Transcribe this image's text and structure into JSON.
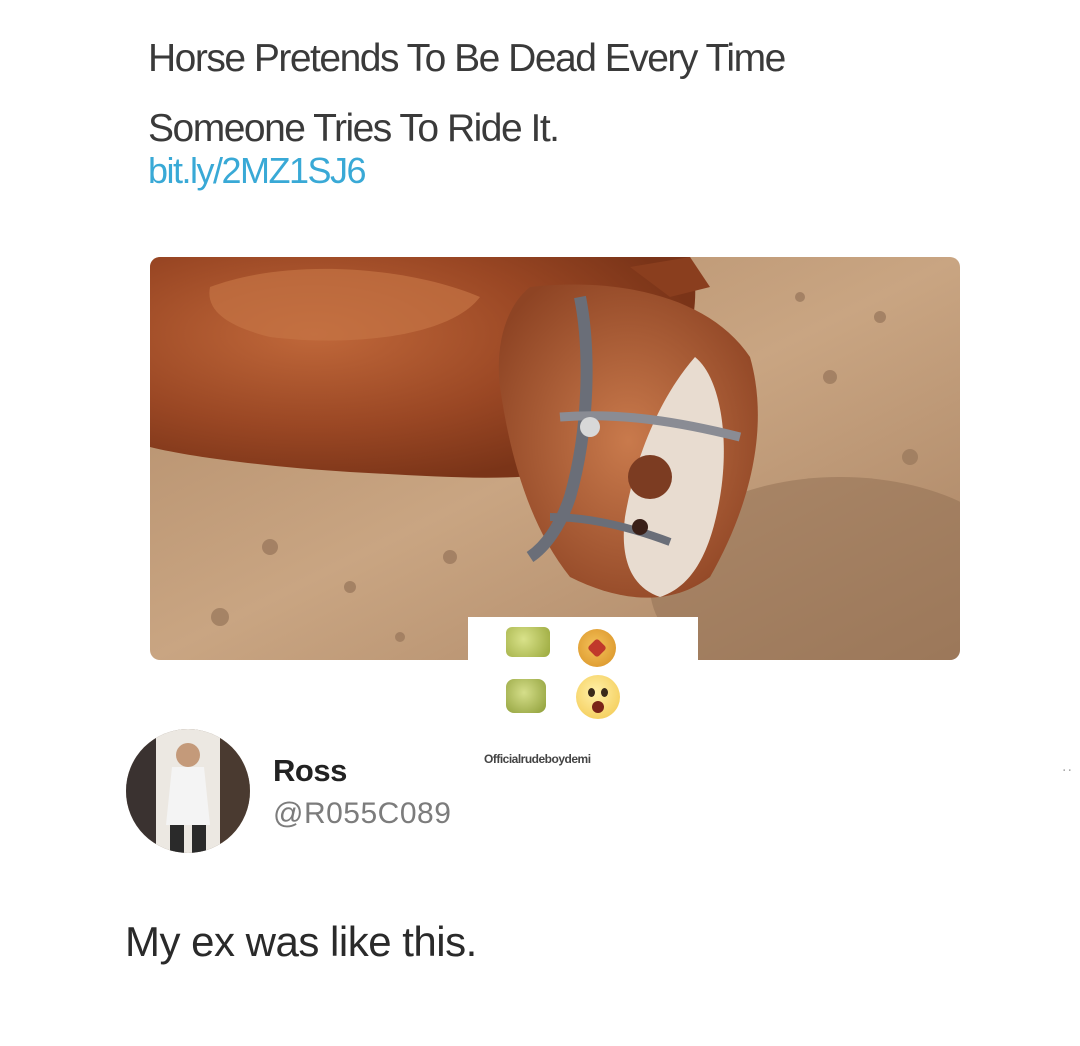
{
  "headline": {
    "line1": "Horse Pretends To Be Dead Every Time",
    "line2": "Someone Tries To Ride It.",
    "link": "bit.ly/2MZ1SJ6"
  },
  "watermark": "Officialrudeboydemi",
  "author": {
    "display_name": "Ross",
    "handle": "@R055C089"
  },
  "reply_text": "My ex was like this.",
  "more_menu": "..",
  "icons": {
    "photo": "lying-horse-image",
    "avatar": "profile-photo",
    "emojis": [
      "laughing-emoji",
      "heart-eyes-emoji",
      "crying-laughing-emoji",
      "shocked-emoji"
    ]
  },
  "colors": {
    "link": "#39a9d6",
    "handle": "#7c7c7c",
    "text": "#2a2a2a"
  }
}
